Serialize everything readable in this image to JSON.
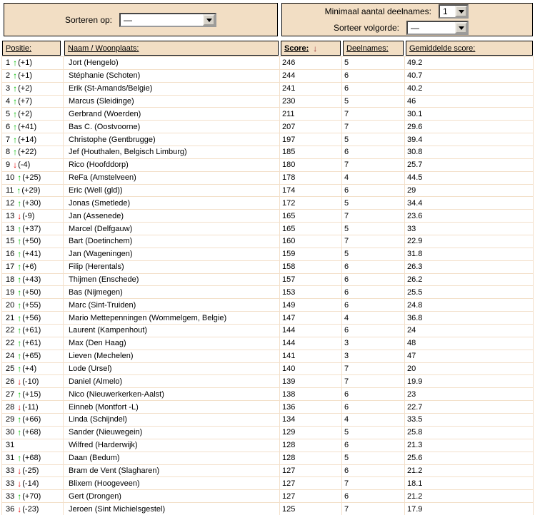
{
  "controls": {
    "sort_by_label": "Sorteren op:",
    "sort_by_value": "—",
    "min_participations_label": "Minimaal aantal deelnames:",
    "min_participations_value": "1",
    "sort_order_label": "Sorteer volgorde:",
    "sort_order_value": "—"
  },
  "table": {
    "headers": {
      "position": "Positie:",
      "name": "Naam / Woonplaats:",
      "score": "Score:",
      "participations": "Deelnames:",
      "average": "Gemiddelde score:"
    },
    "sort_arrow": "↓",
    "rows": [
      {
        "pos": "1",
        "dir": "up",
        "chg": "(+1)",
        "name": "Jort (Hengelo)",
        "score": "246",
        "dln": "5",
        "avg": "49.2"
      },
      {
        "pos": "2",
        "dir": "up",
        "chg": "(+1)",
        "name": "Stéphanie (Schoten)",
        "score": "244",
        "dln": "6",
        "avg": "40.7"
      },
      {
        "pos": "3",
        "dir": "up",
        "chg": "(+2)",
        "name": "Erik (St-Amands/Belgie)",
        "score": "241",
        "dln": "6",
        "avg": "40.2"
      },
      {
        "pos": "4",
        "dir": "up",
        "chg": "(+7)",
        "name": "Marcus (Sleidinge)",
        "score": "230",
        "dln": "5",
        "avg": "46"
      },
      {
        "pos": "5",
        "dir": "up",
        "chg": "(+2)",
        "name": "Gerbrand (Woerden)",
        "score": "211",
        "dln": "7",
        "avg": "30.1"
      },
      {
        "pos": "6",
        "dir": "up",
        "chg": "(+41)",
        "name": "Bas C. (Oostvoorne)",
        "score": "207",
        "dln": "7",
        "avg": "29.6"
      },
      {
        "pos": "7",
        "dir": "up",
        "chg": "(+14)",
        "name": "Christophe (Gentbrugge)",
        "score": "197",
        "dln": "5",
        "avg": "39.4"
      },
      {
        "pos": "8",
        "dir": "up",
        "chg": "(+22)",
        "name": "Jef (Houthalen, Belgisch Limburg)",
        "score": "185",
        "dln": "6",
        "avg": "30.8"
      },
      {
        "pos": "9",
        "dir": "down",
        "chg": "(-4)",
        "name": "Rico (Hoofddorp)",
        "score": "180",
        "dln": "7",
        "avg": "25.7"
      },
      {
        "pos": "10",
        "dir": "up",
        "chg": "(+25)",
        "name": "ReFa (Amstelveen)",
        "score": "178",
        "dln": "4",
        "avg": "44.5"
      },
      {
        "pos": "11",
        "dir": "up",
        "chg": "(+29)",
        "name": "Eric (Well (gld))",
        "score": "174",
        "dln": "6",
        "avg": "29"
      },
      {
        "pos": "12",
        "dir": "up",
        "chg": "(+30)",
        "name": "Jonas (Smetlede)",
        "score": "172",
        "dln": "5",
        "avg": "34.4"
      },
      {
        "pos": "13",
        "dir": "down",
        "chg": "(-9)",
        "name": "Jan (Assenede)",
        "score": "165",
        "dln": "7",
        "avg": "23.6"
      },
      {
        "pos": "13",
        "dir": "up",
        "chg": "(+37)",
        "name": "Marcel (Delfgauw)",
        "score": "165",
        "dln": "5",
        "avg": "33"
      },
      {
        "pos": "15",
        "dir": "up",
        "chg": "(+50)",
        "name": "Bart (Doetinchem)",
        "score": "160",
        "dln": "7",
        "avg": "22.9"
      },
      {
        "pos": "16",
        "dir": "up",
        "chg": "(+41)",
        "name": "Jan (Wageningen)",
        "score": "159",
        "dln": "5",
        "avg": "31.8"
      },
      {
        "pos": "17",
        "dir": "up",
        "chg": "(+6)",
        "name": "Filip (Herentals)",
        "score": "158",
        "dln": "6",
        "avg": "26.3"
      },
      {
        "pos": "18",
        "dir": "up",
        "chg": "(+43)",
        "name": "Thijmen (Enschede)",
        "score": "157",
        "dln": "6",
        "avg": "26.2"
      },
      {
        "pos": "19",
        "dir": "up",
        "chg": "(+50)",
        "name": "Bas (Nijmegen)",
        "score": "153",
        "dln": "6",
        "avg": "25.5"
      },
      {
        "pos": "20",
        "dir": "up",
        "chg": "(+55)",
        "name": "Marc (Sint-Truiden)",
        "score": "149",
        "dln": "6",
        "avg": "24.8"
      },
      {
        "pos": "21",
        "dir": "up",
        "chg": "(+56)",
        "name": "Mario Mettepenningen (Wommelgem, Belgie)",
        "score": "147",
        "dln": "4",
        "avg": "36.8"
      },
      {
        "pos": "22",
        "dir": "up",
        "chg": "(+61)",
        "name": "Laurent (Kampenhout)",
        "score": "144",
        "dln": "6",
        "avg": "24"
      },
      {
        "pos": "22",
        "dir": "up",
        "chg": "(+61)",
        "name": "Max (Den Haag)",
        "score": "144",
        "dln": "3",
        "avg": "48"
      },
      {
        "pos": "24",
        "dir": "up",
        "chg": "(+65)",
        "name": "Lieven (Mechelen)",
        "score": "141",
        "dln": "3",
        "avg": "47"
      },
      {
        "pos": "25",
        "dir": "up",
        "chg": "(+4)",
        "name": "Lode (Ursel)",
        "score": "140",
        "dln": "7",
        "avg": "20"
      },
      {
        "pos": "26",
        "dir": "down",
        "chg": "(-10)",
        "name": "Daniel (Almelo)",
        "score": "139",
        "dln": "7",
        "avg": "19.9"
      },
      {
        "pos": "27",
        "dir": "up",
        "chg": "(+15)",
        "name": "Nico (Nieuwerkerken-Aalst)",
        "score": "138",
        "dln": "6",
        "avg": "23"
      },
      {
        "pos": "28",
        "dir": "down",
        "chg": "(-11)",
        "name": "Einneb (Montfort -L)",
        "score": "136",
        "dln": "6",
        "avg": "22.7"
      },
      {
        "pos": "29",
        "dir": "up",
        "chg": "(+66)",
        "name": "Linda (Schijndel)",
        "score": "134",
        "dln": "4",
        "avg": "33.5"
      },
      {
        "pos": "30",
        "dir": "up",
        "chg": "(+68)",
        "name": "Sander (Nieuwegein)",
        "score": "129",
        "dln": "5",
        "avg": "25.8"
      },
      {
        "pos": "31",
        "dir": "none",
        "chg": "",
        "name": "Wilfred (Harderwijk)",
        "score": "128",
        "dln": "6",
        "avg": "21.3"
      },
      {
        "pos": "31",
        "dir": "up",
        "chg": "(+68)",
        "name": "Daan (Bedum)",
        "score": "128",
        "dln": "5",
        "avg": "25.6"
      },
      {
        "pos": "33",
        "dir": "down",
        "chg": "(-25)",
        "name": "Bram de Vent (Slagharen)",
        "score": "127",
        "dln": "6",
        "avg": "21.2"
      },
      {
        "pos": "33",
        "dir": "down",
        "chg": "(-14)",
        "name": "Blixem (Hoogeveen)",
        "score": "127",
        "dln": "7",
        "avg": "18.1"
      },
      {
        "pos": "33",
        "dir": "up",
        "chg": "(+70)",
        "name": "Gert (Drongen)",
        "score": "127",
        "dln": "6",
        "avg": "21.2"
      },
      {
        "pos": "36",
        "dir": "down",
        "chg": "(-23)",
        "name": "Jeroen (Sint Michielsgestel)",
        "score": "125",
        "dln": "7",
        "avg": "17.9"
      }
    ]
  },
  "colors": {
    "panel_bg": "#F2DEC4",
    "grid_line": "#F3E0CA",
    "up_arrow": "#00BB00",
    "down_arrow": "#E60000",
    "sort_arrow": "#993333"
  }
}
